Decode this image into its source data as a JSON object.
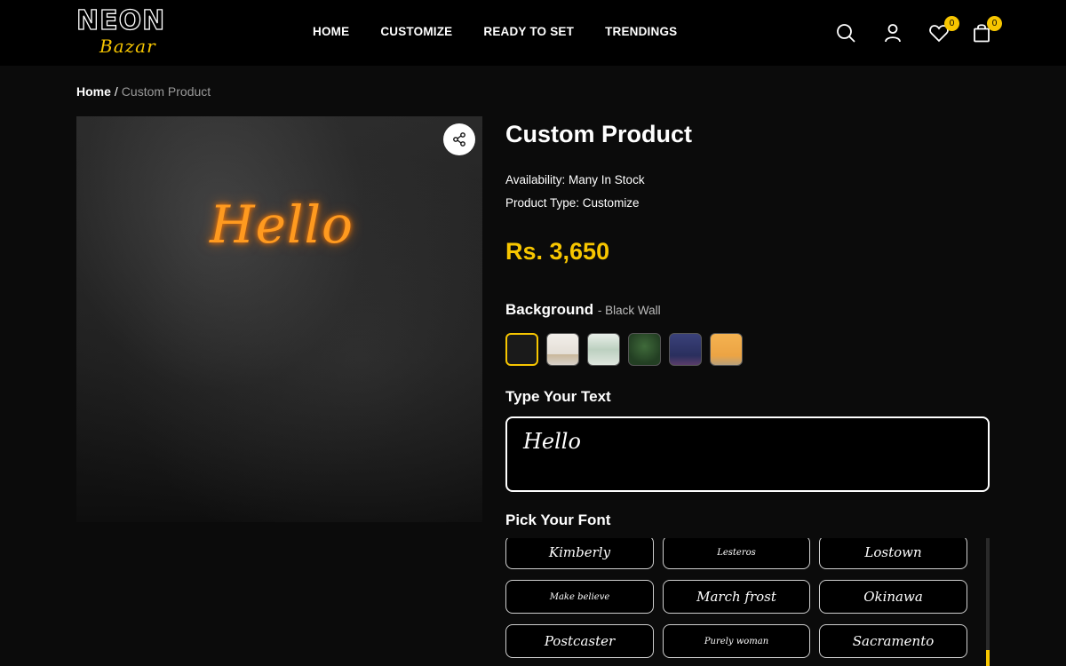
{
  "brand": {
    "name_top": "NEON",
    "name_bottom": "Bazar"
  },
  "nav": [
    {
      "label": "HOME"
    },
    {
      "label": "CUSTOMIZE"
    },
    {
      "label": "READY TO SET"
    },
    {
      "label": "TRENDINGS"
    }
  ],
  "header_icons": {
    "wishlist_count": "0",
    "cart_count": "0"
  },
  "breadcrumb": {
    "home": "Home",
    "separator": "/",
    "current": "Custom Product"
  },
  "product": {
    "neon_text": "Hello",
    "title": "Custom Product",
    "availability": "Availability: Many In Stock",
    "product_type": "Product Type: Customize",
    "price": "Rs. 3,650"
  },
  "background": {
    "label": "Background",
    "selected_name": "- Black Wall",
    "swatches": [
      {
        "name": "black-wall",
        "color": "#1a1a1a"
      },
      {
        "name": "white-room",
        "color": "#e8e4df"
      },
      {
        "name": "green-plant-room",
        "color": "#cfd9d2"
      },
      {
        "name": "green-wall",
        "color": "#2c4a2c"
      },
      {
        "name": "navy-wall",
        "color": "#2e3566"
      },
      {
        "name": "orange-wall",
        "color": "#f0a94a"
      }
    ]
  },
  "text_input": {
    "label": "Type Your Text",
    "value": "Hello"
  },
  "font_picker": {
    "label": "Pick Your Font",
    "options": [
      {
        "label": "Kimberly"
      },
      {
        "label": "Lesteros"
      },
      {
        "label": "Lostown"
      },
      {
        "label": "Make believe"
      },
      {
        "label": "March frost"
      },
      {
        "label": "Okinawa"
      },
      {
        "label": "Postcaster"
      },
      {
        "label": "Purely woman"
      },
      {
        "label": "Sacramento"
      }
    ]
  },
  "colors": {
    "accent": "#f7c600",
    "neon": "#ff9a1f",
    "background": "#0b0b0b",
    "header": "#000000"
  }
}
